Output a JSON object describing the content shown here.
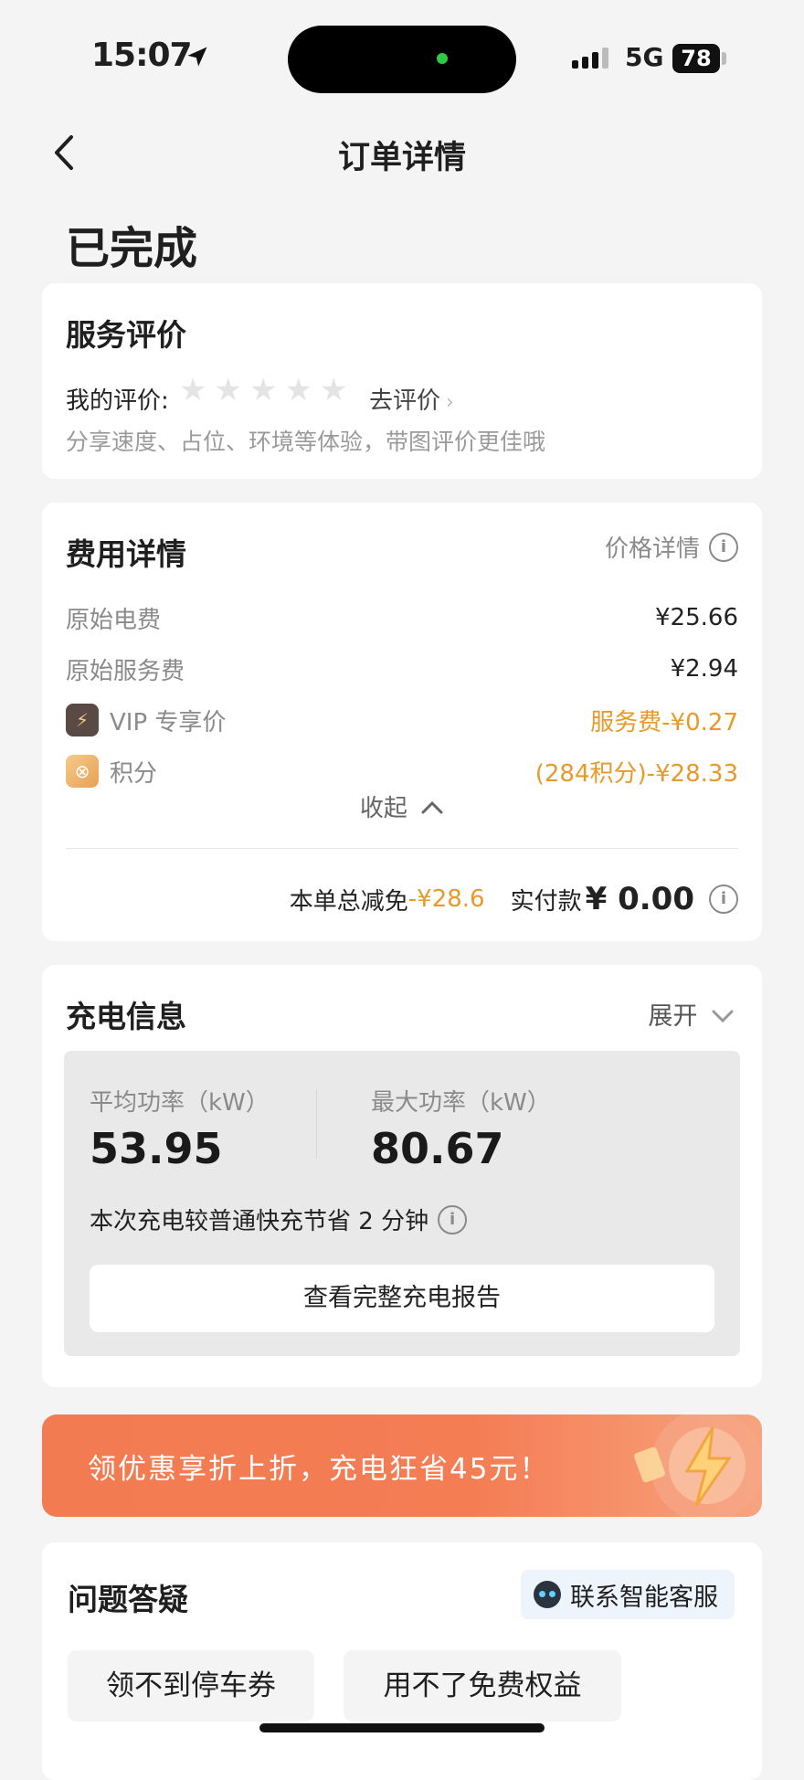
{
  "status_bar": {
    "time": "15:07",
    "network": "5G",
    "battery": "78"
  },
  "header": {
    "title": "订单详情",
    "back_icon": "chevron-left-icon"
  },
  "order": {
    "status": "已完成"
  },
  "rating": {
    "title": "服务评价",
    "my_rating_label": "我的评价:",
    "stars": 5,
    "go_rate": "去评价",
    "hint": "分享速度、占位、环境等体验，带图评价更佳哦"
  },
  "fee": {
    "title": "费用详情",
    "price_detail": "价格详情",
    "rows": [
      {
        "label": "原始电费",
        "value": "¥25.66"
      },
      {
        "label": "原始服务费",
        "value": "¥2.94"
      },
      {
        "label": "VIP 专享价",
        "value": "服务费-¥0.27"
      },
      {
        "label": "积分",
        "value": "(284积分)-¥28.33"
      }
    ],
    "collapse": "收起",
    "total_discount_label": "本单总减免",
    "total_discount_value": "-¥28.6",
    "paid_label": "实付款",
    "paid_value": "¥ 0.00"
  },
  "charge": {
    "title": "充电信息",
    "expand": "展开",
    "avg_power_label": "平均功率（kW）",
    "avg_power_value": "53.95",
    "max_power_label": "最大功率（kW）",
    "max_power_value": "80.67",
    "save_note": "本次充电较普通快充节省 2 分钟",
    "report_button": "查看完整充电报告"
  },
  "banner": {
    "text": "领优惠享折上折，充电狂省45元！"
  },
  "faq": {
    "title": "问题答疑",
    "customer_service": "联系智能客服",
    "chips": [
      "领不到停车券",
      "用不了免费权益"
    ]
  },
  "colors": {
    "accent_orange": "#e79a2a",
    "banner": "#f27b52",
    "background": "#f4f4f4"
  }
}
